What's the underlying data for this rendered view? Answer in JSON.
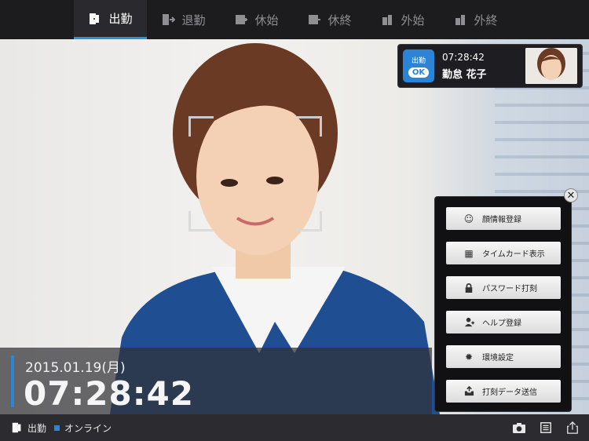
{
  "tabs": [
    {
      "label": "出勤",
      "icon": "clock-in-door-icon",
      "active": true
    },
    {
      "label": "退勤",
      "icon": "clock-out-door-icon",
      "active": false
    },
    {
      "label": "休始",
      "icon": "break-start-icon",
      "active": false
    },
    {
      "label": "休終",
      "icon": "break-end-icon",
      "active": false
    },
    {
      "label": "外始",
      "icon": "outing-start-icon",
      "active": false
    },
    {
      "label": "外終",
      "icon": "outing-end-icon",
      "active": false
    }
  ],
  "result": {
    "badge_label": "出勤",
    "ok_label": "OK",
    "time": "07:28:42",
    "name": "勤怠 花子"
  },
  "menu": {
    "items": [
      {
        "label": "顔情報登録",
        "icon": "face-icon"
      },
      {
        "label": "タイムカード表示",
        "icon": "calendar-icon"
      },
      {
        "label": "パスワード打刻",
        "icon": "lock-icon"
      },
      {
        "label": "ヘルプ登録",
        "icon": "add-user-icon"
      },
      {
        "label": "環境設定",
        "icon": "gear-icon"
      },
      {
        "label": "打刻データ送信",
        "icon": "send-tray-icon"
      }
    ]
  },
  "clock": {
    "date": "2015.01.19(月)",
    "time": "07:28:42"
  },
  "status": {
    "mode_label": "出勤",
    "connection_label": "オンライン"
  },
  "colors": {
    "accent": "#2b84d6",
    "bar_bg": "#1c1c1f"
  }
}
